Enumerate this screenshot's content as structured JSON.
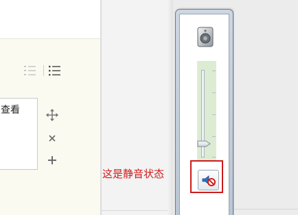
{
  "editor": {
    "toolbar": {
      "ordered_list_icon": "ordered-list-icon",
      "unordered_list_icon": "unordered-list-icon"
    },
    "card": {
      "text": "查看"
    },
    "tools": [
      "move-icon",
      "close-icon",
      "plus-icon"
    ]
  },
  "annotation": {
    "text": "这是静音状态",
    "color": "#d01818"
  },
  "volume_mixer": {
    "device_icon": "speaker-device-icon",
    "level_fraction": 0.1,
    "muted": true,
    "mute_icon": "muted-speaker-icon",
    "highlight_color": "#cc1a1a"
  }
}
